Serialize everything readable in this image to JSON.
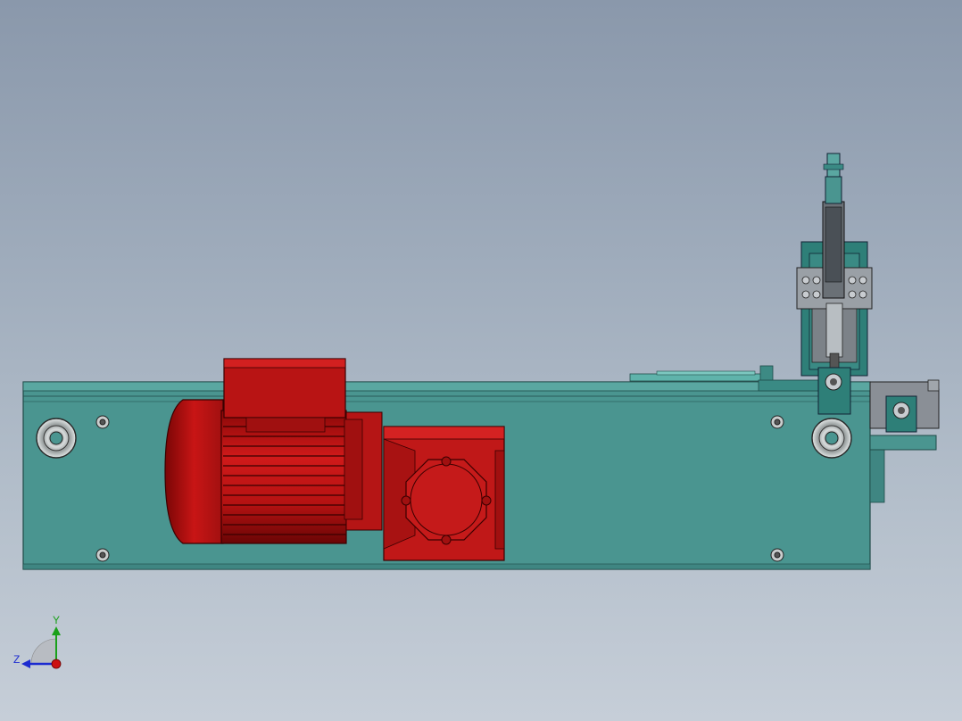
{
  "viewport": {
    "background_top": "#8a98ab",
    "background_bottom": "#c6ced8"
  },
  "model": {
    "base_plate_color": "#4a9590",
    "motor_color": "#b01010",
    "gearbox_color": "#c01818",
    "fixture_color": "#2e7f78",
    "steel_color": "#9aa0a6"
  },
  "triad": {
    "y_label": "Y",
    "z_label": "Z",
    "y_color": "#1aa01a",
    "z_color": "#1c2bd0",
    "x_color": "#cc1010"
  },
  "icons": [
    "triad-icon",
    "origin-dot-icon"
  ]
}
